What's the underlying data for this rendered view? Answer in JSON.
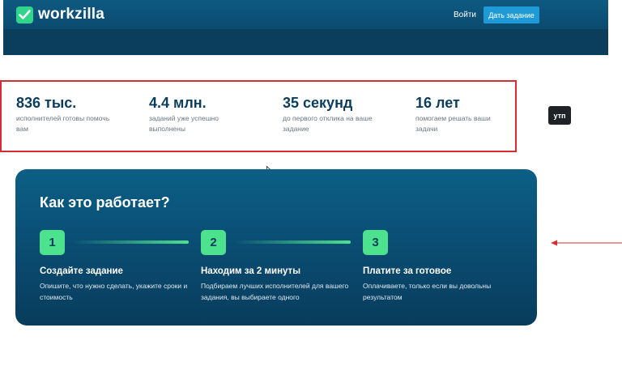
{
  "header": {
    "logo_text": "workzilla",
    "login_label": "Войти",
    "post_task_label": "Дать задание"
  },
  "stats": [
    {
      "value": "836 тыс.",
      "desc": "исполнителей готовы помочь вам"
    },
    {
      "value": "4.4 млн.",
      "desc": "заданий уже успешно выполнены"
    },
    {
      "value": "35 секунд",
      "desc": "до первого отклика на ваше задание"
    },
    {
      "value": "16 лет",
      "desc": "помогаем решать ваши задачи"
    }
  ],
  "annotation": {
    "badge": "утп",
    "outline_color": "#d62d35"
  },
  "how_it_works": {
    "title": "Как это работает?",
    "steps": [
      {
        "number": "1",
        "title": "Создайте задание",
        "desc": "Опишите, что нужно сделать, укажите сроки и стоимость"
      },
      {
        "number": "2",
        "title": "Находим за 2 минуты",
        "desc": "Подбираем лучших исполнителей для вашего задания, вы выбираете одного"
      },
      {
        "number": "3",
        "title": "Платите за готовое",
        "desc": "Оплачиваете, только если вы довольны результатом"
      }
    ]
  },
  "colors": {
    "accent": "#4de28d",
    "brand_dark": "#0b3d5c",
    "button": "#1e9bd7"
  },
  "icons": {
    "logo": "checkmark-icon",
    "cursor": "mouse-pointer-icon",
    "arrow": "arrow-left-icon"
  }
}
